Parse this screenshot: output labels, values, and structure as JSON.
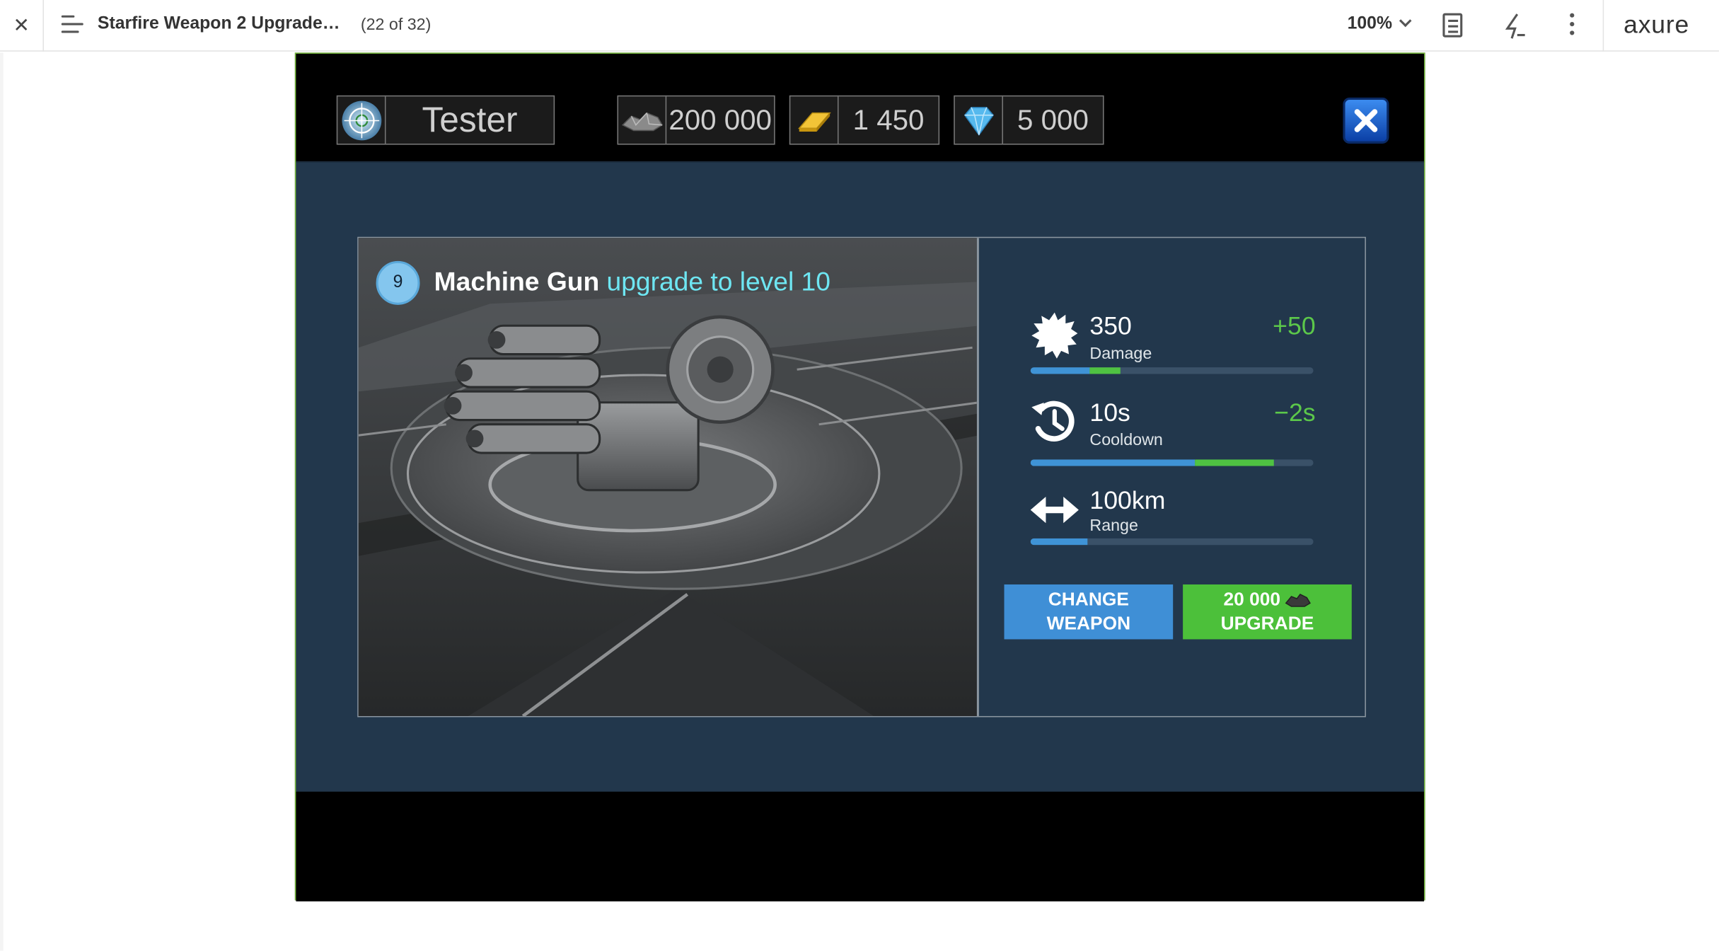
{
  "toolbar": {
    "title": "Starfire Weapon 2 Upgrade…",
    "page_count": "(22 of 32)",
    "zoom": "100%",
    "logo": "axure"
  },
  "hud": {
    "player_name": "Tester",
    "ore": "200 000",
    "gold": "1 450",
    "gems": "5 000"
  },
  "weapon": {
    "level": "9",
    "name": "Machine Gun",
    "upgrade_text": "upgrade to level 10"
  },
  "stats": {
    "damage": {
      "value": "350",
      "label": "Damage",
      "delta": "+50",
      "base_fraction": 0.21,
      "gain_fraction": 0.11
    },
    "cooldown": {
      "value": "10s",
      "label": "Cooldown",
      "delta": "−2s",
      "base_fraction": 0.58,
      "gain_fraction": 0.28
    },
    "range": {
      "value": "100km",
      "label": "Range",
      "base_fraction": 0.2
    }
  },
  "buttons": {
    "change_line1": "CHANGE",
    "change_line2": "WEAPON",
    "upgrade_cost": "20 000",
    "upgrade_label": "UPGRADE"
  },
  "colors": {
    "accent_blue": "#3f8fd6",
    "accent_green": "#4cc03a",
    "upgrade_text": "#6ee6f2",
    "panel_bg": "#22374c"
  },
  "icons": {
    "close": "close-icon",
    "menu": "menu-icon",
    "damage": "burst-icon",
    "cooldown": "history-icon",
    "range": "double-arrow-icon"
  }
}
